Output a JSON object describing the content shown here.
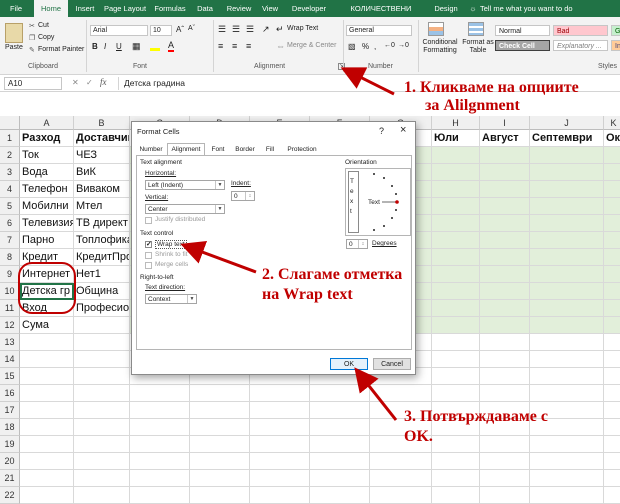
{
  "ribbon": {
    "tabs": [
      "File",
      "Home",
      "Insert",
      "Page Layout",
      "Formulas",
      "Data",
      "Review",
      "View",
      "Developer",
      "КОЛИЧЕСТВЕНИ СМЕТКИ",
      "Design"
    ],
    "tell_me": "Tell me what you want to do",
    "paste": "Paste",
    "cut": "Cut",
    "copy": "Copy",
    "format_painter": "Format Painter",
    "clipboard": "Clipboard",
    "font_name": "Arial",
    "font_size": "10",
    "font_group": "Font",
    "bold": "B",
    "italic": "I",
    "underline": "U",
    "wrap_text": "Wrap Text",
    "merge_center": "Merge & Center",
    "alignment_group": "Alignment",
    "number_format": "General",
    "number_group": "Number",
    "conditional_formatting": "Conditional Formatting",
    "format_as_table": "Format as Table",
    "styles_group": "Styles",
    "style_normal": "Normal",
    "style_bad": "Bad",
    "style_good": "Go",
    "style_check": "Check Cell",
    "style_explanatory": "Explanatory ...",
    "style_in": "In"
  },
  "formula_bar": {
    "name_box": "A10",
    "fx": "fx",
    "content": "Детска градина"
  },
  "grid": {
    "columns": [
      "A",
      "B",
      "C",
      "D",
      "E",
      "F",
      "G",
      "H",
      "I",
      "J",
      "K"
    ],
    "rows": [
      "1",
      "2",
      "3",
      "4",
      "5",
      "6",
      "7",
      "8",
      "9",
      "10",
      "11",
      "12",
      "13",
      "14",
      "15",
      "16",
      "17",
      "18",
      "19",
      "20",
      "21",
      "22"
    ],
    "col_a": [
      "Разход",
      "Ток",
      "Вода",
      "Телефон",
      "Мобилни",
      "Телевизия",
      "Парно",
      "Кредит",
      "Интернет",
      "Детска гр",
      "Вход",
      "Сума"
    ],
    "col_b": [
      "Доставчик",
      "ЧЕЗ",
      "ВиК",
      "Виваком",
      "Мтел",
      "ТВ директ",
      "Топлофикация",
      "КредитПро",
      "Нет1",
      "Община",
      "Професионалист",
      ""
    ],
    "right_headers": [
      "Юли",
      "Август",
      "Септември",
      "Ок"
    ]
  },
  "dialog": {
    "title": "Format Cells",
    "help": "?",
    "close": "×",
    "tabs": [
      "Number",
      "Alignment",
      "Font",
      "Border",
      "Fill",
      "Protection"
    ],
    "text_alignment": "Text alignment",
    "horizontal_label": "Horizontal:",
    "horizontal_value": "Left (Indent)",
    "indent_label": "Indent:",
    "indent_value": "0",
    "vertical_label": "Vertical:",
    "vertical_value": "Center",
    "justify_distributed": "Justify distributed",
    "text_control": "Text control",
    "wrap_text": "Wrap text",
    "shrink_to_fit": "Shrink to fit",
    "merge_cells": "Merge cells",
    "right_to_left": "Right-to-left",
    "text_direction_label": "Text direction:",
    "text_direction_value": "Context",
    "orientation": "Orientation",
    "orientation_text_vertical": "T e x t",
    "orientation_text": "Text",
    "degrees_value": "0",
    "degrees_label": "Degrees",
    "ok": "OK",
    "cancel": "Cancel"
  },
  "annotations": {
    "step1_line1": "1. Кликваме на опциите",
    "step1_line2": "за Alilgnment",
    "step2_line1": "2. Слагаме отметка",
    "step2_line2": "на Wrap text",
    "step3_line1": "3. Потвърждаваме с",
    "step3_line2": "OK.",
    "color": "#c00000"
  }
}
